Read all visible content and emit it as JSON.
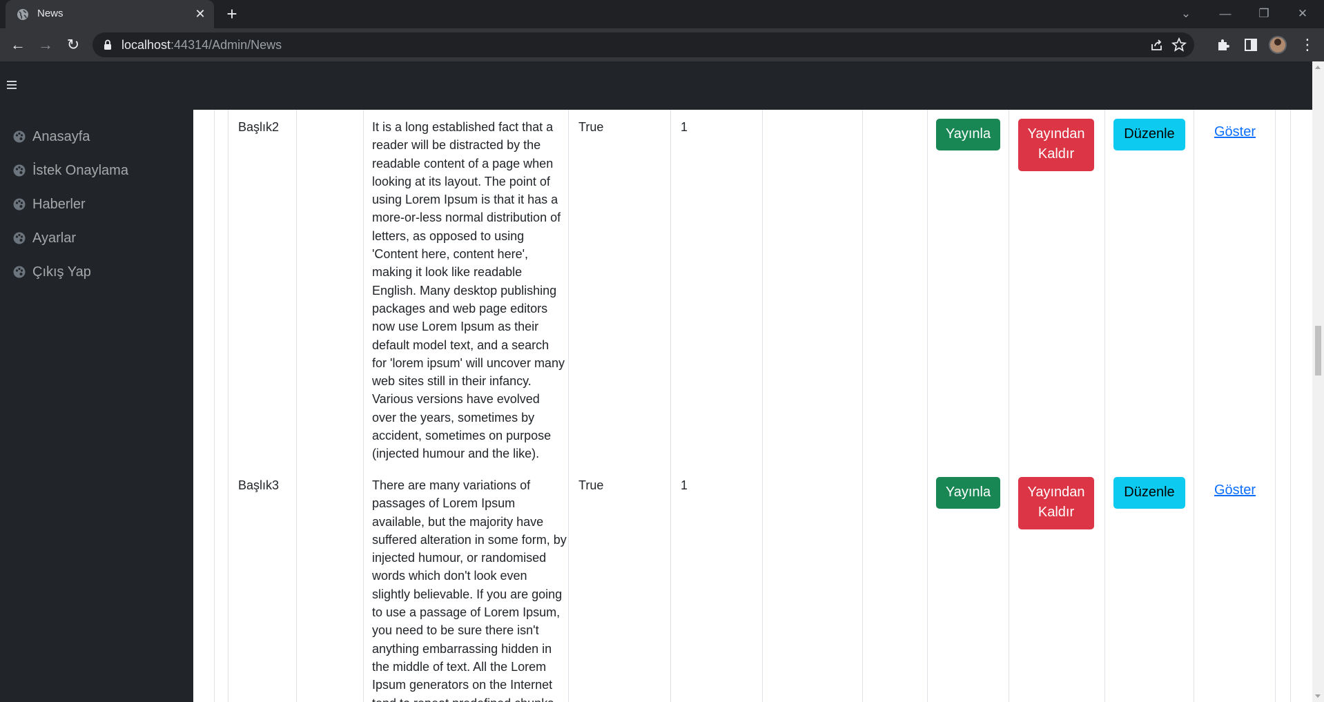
{
  "browser": {
    "tab_title": "News",
    "url_host": "localhost",
    "url_rest": ":44314/Admin/News"
  },
  "sidebar": {
    "items": [
      {
        "label": "Anasayfa",
        "icon": "palette-icon"
      },
      {
        "label": "İstek Onaylama",
        "icon": "palette-icon"
      },
      {
        "label": "Haberler",
        "icon": "palette-icon"
      },
      {
        "label": "Ayarlar",
        "icon": "palette-icon"
      },
      {
        "label": "Çıkış Yap",
        "icon": "palette-icon"
      }
    ]
  },
  "table": {
    "rows": [
      {
        "title": "Başlık2",
        "content": "It is a long established fact that a reader will be distracted by the readable content of a page when looking at its layout. The point of using Lorem Ipsum is that it has a more-or-less normal distribution of letters, as opposed to using 'Content here, content here', making it look like readable English. Many desktop publishing packages and web page editors now use Lorem Ipsum as their default model text, and a search for 'lorem ipsum' will uncover many web sites still in their infancy. Various versions have evolved over the years, sometimes by accident, sometimes on purpose (injected humour and the like).",
        "status": "True",
        "count": "1",
        "publish_label": "Yayınla",
        "unpublish_label": "Yayından Kaldır",
        "edit_label": "Düzenle",
        "show_label": "Göster"
      },
      {
        "title": "Başlık3",
        "content": "There are many variations of passages of Lorem Ipsum available, but the majority have suffered alteration in some form, by injected humour, or randomised words which don't look even slightly believable. If you are going to use a passage of Lorem Ipsum, you need to be sure there isn't anything embarrassing hidden in the middle of text. All the Lorem Ipsum generators on the Internet tend to repeat predefined chunks",
        "status": "True",
        "count": "1",
        "publish_label": "Yayınla",
        "unpublish_label": "Yayından Kaldır",
        "edit_label": "Düzenle",
        "show_label": "Göster"
      }
    ]
  },
  "colors": {
    "sidebar_bg": "#212529",
    "success": "#198754",
    "danger": "#dc3545",
    "info": "#0dcaf0",
    "link": "#0d6efd"
  }
}
